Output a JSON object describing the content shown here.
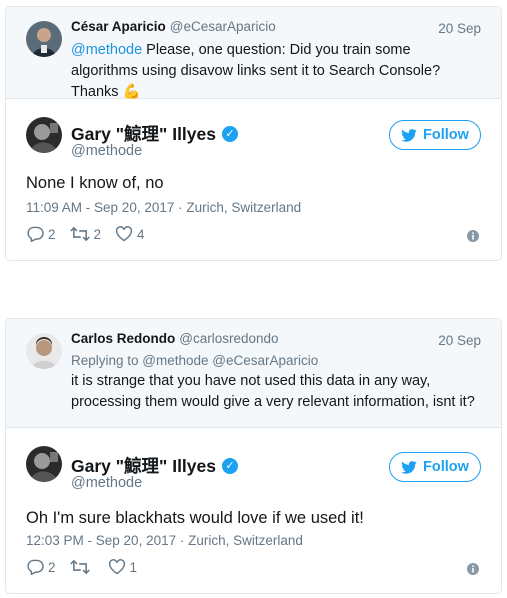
{
  "tweets": [
    {
      "quoted": {
        "name": "César Aparicio",
        "handle": "@eCesarAparicio",
        "date": "20 Sep",
        "replying_to": "",
        "mention": "@methode",
        "text": " Please, one question: Did you train some algorithms using disavow links sent it to Search Console? Thanks 💪"
      },
      "main": {
        "name": "Gary \"鯨理\" Illyes",
        "handle": "@methode",
        "follow_label": "Follow",
        "text": "None I know of, no",
        "meta": "11:09 AM - Sep 20, 2017 · Zurich, Switzerland",
        "replies": "2",
        "retweets": "2",
        "likes": "4"
      }
    },
    {
      "quoted": {
        "name": "Carlos Redondo",
        "handle": "@carlosredondo",
        "date": "20 Sep",
        "replying_to": "Replying to @methode @eCesarAparicio",
        "mention": "",
        "text": "it is strange that you have not used this data in any way, processing them would give a very relevant information, isnt it?"
      },
      "main": {
        "name": "Gary \"鯨理\" Illyes",
        "handle": "@methode",
        "follow_label": "Follow",
        "text": "Oh I'm sure blackhats would love if we used it!",
        "meta": "12:03 PM - Sep 20, 2017 · Zurich, Switzerland",
        "replies": "2",
        "retweets": "",
        "likes": "1"
      }
    }
  ],
  "icons": {
    "verified": "verified-badge-icon",
    "bird": "twitter-bird-icon",
    "reply": "reply-icon",
    "retweet": "retweet-icon",
    "like": "heart-icon",
    "info": "info-icon"
  },
  "colors": {
    "accent": "#1da1f2",
    "link": "#1b95e0",
    "muted": "#657786",
    "quoted_bg": "#f5f8fa"
  }
}
